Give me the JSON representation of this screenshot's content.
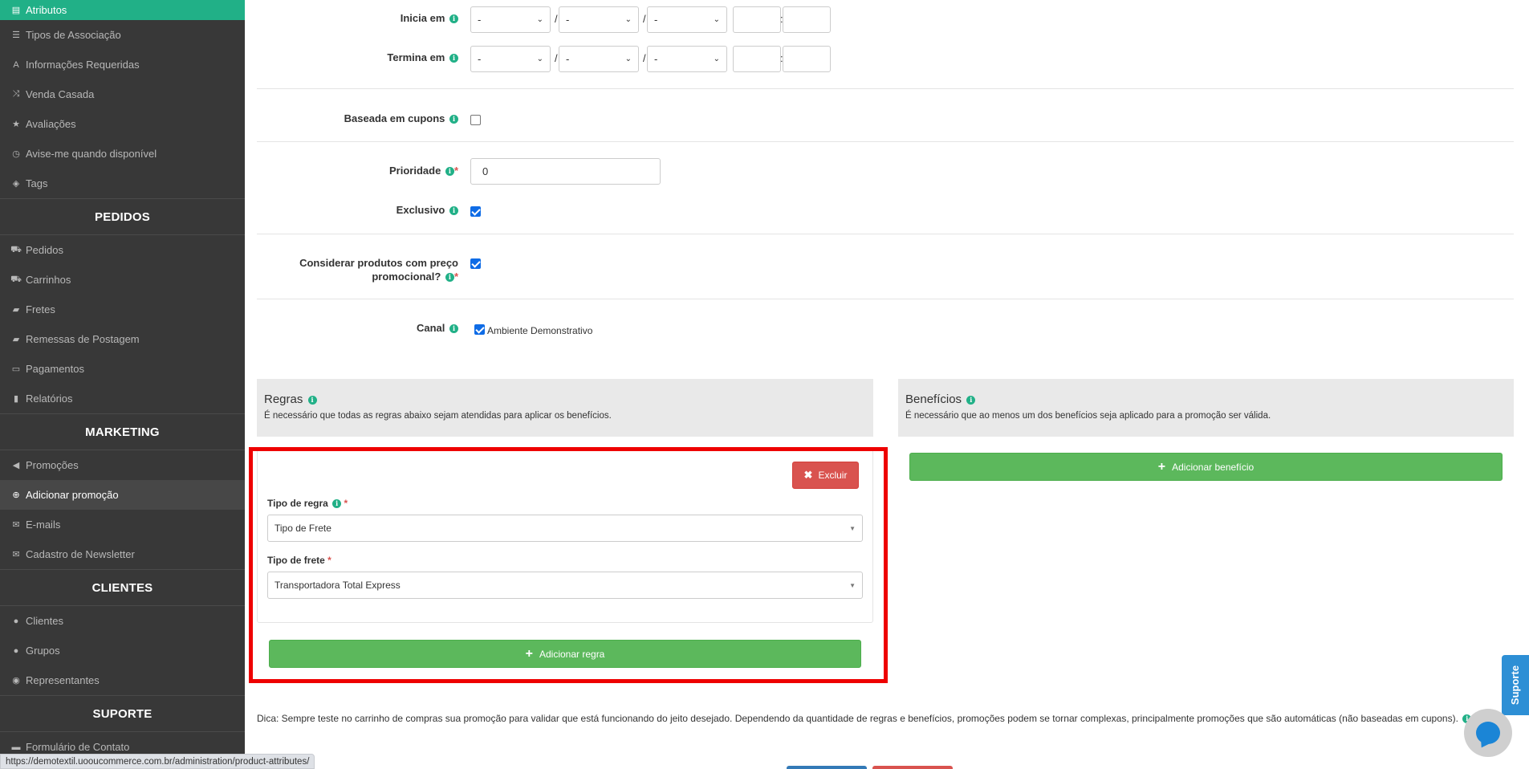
{
  "sidebar": {
    "top_item": "Atributos",
    "catalog_items": [
      {
        "label": "Tipos de Associação",
        "icon": "list-icon"
      },
      {
        "label": "Informações Requeridas",
        "icon": "font-icon"
      },
      {
        "label": "Venda Casada",
        "icon": "random-icon"
      },
      {
        "label": "Avaliações",
        "icon": "star-icon"
      },
      {
        "label": "Avise-me quando disponível",
        "icon": "clock-icon"
      },
      {
        "label": "Tags",
        "icon": "tag-icon"
      }
    ],
    "sections": {
      "pedidos": "PEDIDOS",
      "marketing": "MARKETING",
      "clientes": "CLIENTES",
      "suporte": "SUPORTE"
    },
    "pedidos_items": [
      {
        "label": "Pedidos",
        "icon": "cart-icon"
      },
      {
        "label": "Carrinhos",
        "icon": "cart-icon"
      },
      {
        "label": "Fretes",
        "icon": "truck-icon"
      },
      {
        "label": "Remessas de Postagem",
        "icon": "truck-icon"
      },
      {
        "label": "Pagamentos",
        "icon": "money-icon"
      },
      {
        "label": "Relatórios",
        "icon": "bar-chart-icon"
      }
    ],
    "marketing_items": [
      {
        "label": "Promoções",
        "icon": "bullhorn-icon"
      },
      {
        "label": "Adicionar promoção",
        "icon": "plus-circle-icon"
      },
      {
        "label": "E-mails",
        "icon": "envelope-icon"
      },
      {
        "label": "Cadastro de Newsletter",
        "icon": "envelope-icon"
      }
    ],
    "clientes_items": [
      {
        "label": "Clientes",
        "icon": "user-icon"
      },
      {
        "label": "Grupos",
        "icon": "users-icon"
      },
      {
        "label": "Representantes",
        "icon": "user-circle-icon"
      }
    ],
    "suporte_items": [
      {
        "label": "Formulário de Contato",
        "icon": "comment-icon"
      }
    ]
  },
  "form": {
    "inicia_label": "Inicia em",
    "termina_label": "Termina em",
    "date_placeholder": "-",
    "date_sep": "/",
    "time_sep": ":",
    "cupons_label": "Baseada em cupons",
    "prioridade_label": "Prioridade",
    "prioridade_value": "0",
    "exclusivo_label": "Exclusivo",
    "considerar_label_line1": "Considerar produtos com preço",
    "considerar_label_line2": "promocional?",
    "canal_label": "Canal",
    "canal_option": "Ambiente Demonstrativo",
    "required_mark": "*"
  },
  "regras": {
    "title": "Regras",
    "description": "É necessário que todas as regras abaixo sejam atendidas para aplicar os benefícios.",
    "excluir_label": "Excluir",
    "tipo_regra_label": "Tipo de regra",
    "tipo_regra_value": "Tipo de Frete",
    "tipo_frete_label": "Tipo de frete",
    "tipo_frete_value": "Transportadora Total Express",
    "add_label": "Adicionar regra"
  },
  "beneficios": {
    "title": "Benefícios",
    "description": "É necessário que ao menos um dos benefícios seja aplicado para a promoção ser válida.",
    "add_label": "Adicionar benefício"
  },
  "tip": "Dica: Sempre teste no carrinho de compras sua promoção para validar que está funcionando do jeito desejado. Dependendo da quantidade de regras e benefícios, promoções podem se tornar complexas, principalmente promoções que são automáticas (não baseadas em cupons).",
  "status_url": "https://demotextil.uooucommerce.com.br/administration/product-attributes/",
  "support_tab": "Suporte",
  "colors": {
    "accent": "#21b087",
    "sidebar_bg": "#383838",
    "success": "#5cb85c",
    "danger": "#d9534f",
    "highlight": "#ee0000"
  }
}
